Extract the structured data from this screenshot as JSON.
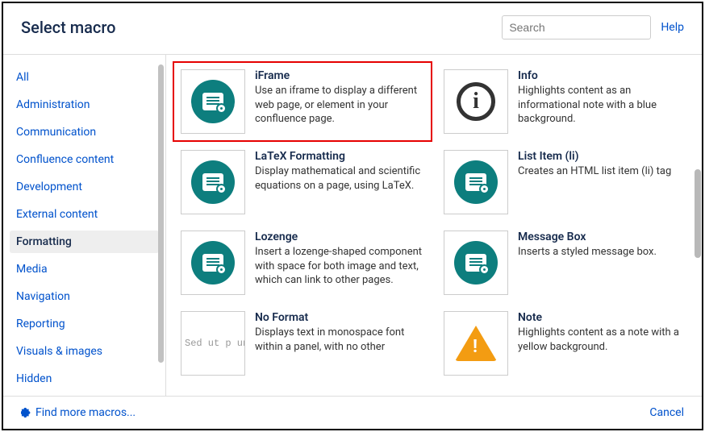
{
  "header": {
    "title": "Select macro",
    "search_placeholder": "Search",
    "help": "Help"
  },
  "sidebar": {
    "categories": [
      {
        "label": "All",
        "active": false
      },
      {
        "label": "Administration",
        "active": false
      },
      {
        "label": "Communication",
        "active": false
      },
      {
        "label": "Confluence content",
        "active": false
      },
      {
        "label": "Development",
        "active": false
      },
      {
        "label": "External content",
        "active": false
      },
      {
        "label": "Formatting",
        "active": true
      },
      {
        "label": "Media",
        "active": false
      },
      {
        "label": "Navigation",
        "active": false
      },
      {
        "label": "Reporting",
        "active": false
      },
      {
        "label": "Visuals & images",
        "active": false
      },
      {
        "label": "Hidden",
        "active": false
      }
    ]
  },
  "macros": [
    {
      "title": "iFrame",
      "desc": "Use an iframe to display a different web page, or element in your confluence page.",
      "icon": "doc",
      "highlight": true
    },
    {
      "title": "Info",
      "desc": "Highlights content as an informational note with a blue background.",
      "icon": "info",
      "highlight": false
    },
    {
      "title": "LaTeX Formatting",
      "desc": "Display mathematical and scientific equations on a page, using LaTeX.",
      "icon": "doc",
      "highlight": false
    },
    {
      "title": "List Item (li)",
      "desc": "Creates an HTML list item (li) tag",
      "icon": "doc",
      "highlight": false
    },
    {
      "title": "Lozenge",
      "desc": "Insert a lozenge-shaped component with space for both image and text, which can link to other pages.",
      "icon": "doc",
      "highlight": false
    },
    {
      "title": "Message Box",
      "desc": "Inserts a styled message box.",
      "icon": "doc",
      "highlight": false
    },
    {
      "title": "No Format",
      "desc": "Displays text in monospace font within a panel, with no other",
      "icon": "mono",
      "highlight": false,
      "mono_text": "Sed ut p\nunde omn"
    },
    {
      "title": "Note",
      "desc": "Highlights content as a note with a yellow background.",
      "icon": "warn",
      "highlight": false
    }
  ],
  "footer": {
    "find_more": "Find more macros...",
    "cancel": "Cancel"
  }
}
